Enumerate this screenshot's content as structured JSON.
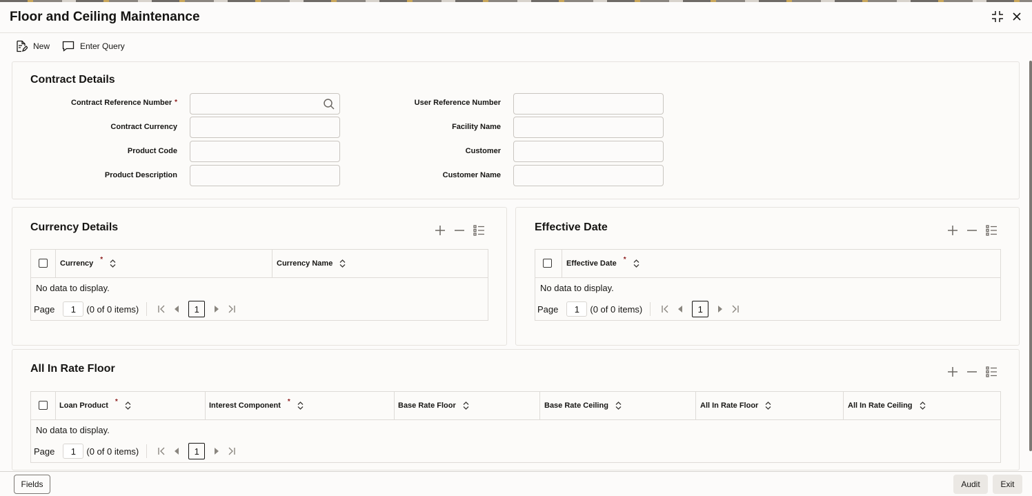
{
  "window": {
    "title": "Floor and Ceiling Maintenance"
  },
  "toolbar": {
    "new_label": "New",
    "enter_query_label": "Enter Query"
  },
  "contract_details": {
    "title": "Contract Details",
    "left_fields": [
      {
        "label": "Contract Reference Number",
        "required": "*",
        "value": ""
      },
      {
        "label": "Contract Currency",
        "value": ""
      },
      {
        "label": "Product Code",
        "value": ""
      },
      {
        "label": "Product Description",
        "value": ""
      }
    ],
    "right_fields": [
      {
        "label": "User Reference Number",
        "value": ""
      },
      {
        "label": "Facility Name",
        "value": ""
      },
      {
        "label": "Customer",
        "value": ""
      },
      {
        "label": "Customer Name",
        "value": ""
      }
    ]
  },
  "currency_details": {
    "title": "Currency Details",
    "columns": [
      {
        "label": "Currency",
        "required": "*"
      },
      {
        "label": "Currency Name"
      }
    ],
    "empty_text": "No data to display.",
    "pager": {
      "page_label": "Page",
      "page_value": "1",
      "items_text": "(0 of 0 items)",
      "current_page": "1"
    }
  },
  "effective_date": {
    "title": "Effective Date",
    "columns": [
      {
        "label": "Effective Date",
        "required": "*"
      }
    ],
    "empty_text": "No data to display.",
    "pager": {
      "page_label": "Page",
      "page_value": "1",
      "items_text": "(0 of 0 items)",
      "current_page": "1"
    }
  },
  "all_in_rate_floor": {
    "title": "All In Rate Floor",
    "columns": [
      {
        "label": "Loan Product",
        "required": "*"
      },
      {
        "label": "Interest Component",
        "required": "*"
      },
      {
        "label": "Base Rate Floor"
      },
      {
        "label": "Base Rate Ceiling"
      },
      {
        "label": "All In Rate Floor"
      },
      {
        "label": "All In Rate Ceiling"
      }
    ],
    "empty_text": "No data to display.",
    "pager": {
      "page_label": "Page",
      "page_value": "1",
      "items_text": "(0 of 0 items)",
      "current_page": "1"
    }
  },
  "footer": {
    "fields_label": "Fields",
    "audit_label": "Audit",
    "exit_label": "Exit"
  },
  "colors": {
    "text": "#161513",
    "border": "#dedbd7",
    "required": "#8c1b1b",
    "background": "#fcfbfa"
  }
}
